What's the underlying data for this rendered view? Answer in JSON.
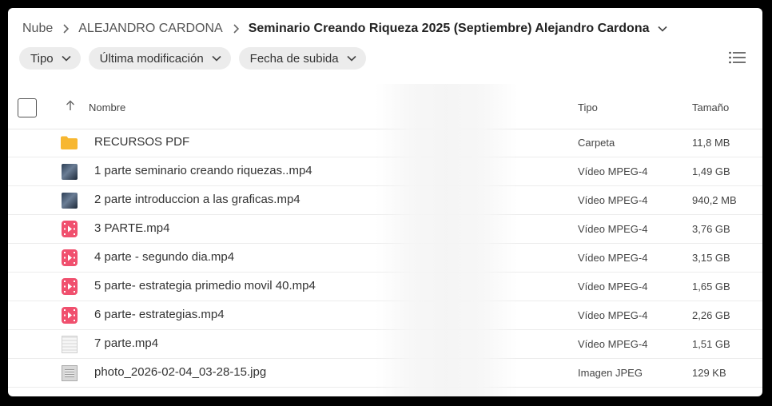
{
  "breadcrumb": {
    "items": [
      "Nube",
      "ALEJANDRO CARDONA"
    ],
    "current": "Seminario Creando Riqueza 2025 (Septiembre) Alejandro Cardona"
  },
  "filters": [
    "Tipo",
    "Última modificación",
    "Fecha de subida"
  ],
  "columns": {
    "name": "Nombre",
    "type": "Tipo",
    "size": "Tamaño"
  },
  "colors": {
    "folder": "#f7b731",
    "video": "#f0506e"
  },
  "files": [
    {
      "name": "RECURSOS PDF",
      "type": "Carpeta",
      "size": "11,8 MB",
      "icon": "folder-icon"
    },
    {
      "name": "1 parte seminario creando riquezas..mp4",
      "type": "Vídeo MPEG-4",
      "size": "1,49 GB",
      "icon": "video-thumbnail-icon"
    },
    {
      "name": "2 parte introduccion a las graficas.mp4",
      "type": "Vídeo MPEG-4",
      "size": "940,2 MB",
      "icon": "video-thumbnail-icon"
    },
    {
      "name": "3 PARTE.mp4",
      "type": "Vídeo MPEG-4",
      "size": "3,76 GB",
      "icon": "video-file-icon"
    },
    {
      "name": "4 parte - segundo dia.mp4",
      "type": "Vídeo MPEG-4",
      "size": "3,15 GB",
      "icon": "video-file-icon"
    },
    {
      "name": "5 parte- estrategia primedio movil 40.mp4",
      "type": "Vídeo MPEG-4",
      "size": "1,65 GB",
      "icon": "video-file-icon"
    },
    {
      "name": "6 parte- estrategias.mp4",
      "type": "Vídeo MPEG-4",
      "size": "2,26 GB",
      "icon": "video-file-icon"
    },
    {
      "name": "7 parte.mp4",
      "type": "Vídeo MPEG-4",
      "size": "1,51 GB",
      "icon": "video-thumbnail-icon"
    },
    {
      "name": "photo_2026-02-04_03-28-15.jpg",
      "type": "Imagen JPEG",
      "size": "129 KB",
      "icon": "image-thumbnail-icon"
    }
  ]
}
